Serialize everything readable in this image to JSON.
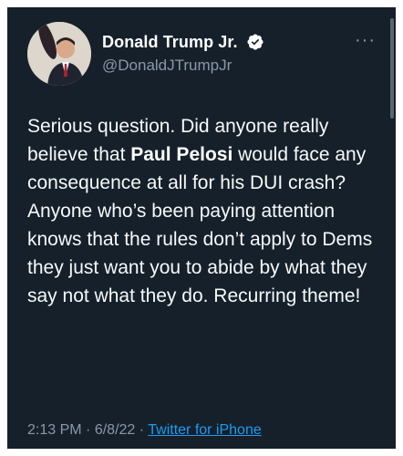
{
  "author": {
    "display_name": "Donald Trump Jr.",
    "handle": "@DonaldJTrumpJr",
    "verified": true
  },
  "menu_label": "···",
  "tweet": {
    "before": "Serious question. Did anyone really believe that ",
    "highlight": "Paul Pelosi",
    "after": " would face any consequence at all for his DUI crash? Anyone who’s been paying attention knows that the rules don’t apply to Dems they just want you to abide by what they say not what they do. Recurring theme!"
  },
  "meta": {
    "time": "2:13 PM",
    "date": "6/8/22",
    "separator": "·",
    "source": "Twitter for iPhone"
  },
  "colors": {
    "background": "#15202b",
    "text": "#f7f9f9",
    "secondary": "#8b98a5",
    "link": "#1d9bf0",
    "verified": "#1d9bf0"
  }
}
